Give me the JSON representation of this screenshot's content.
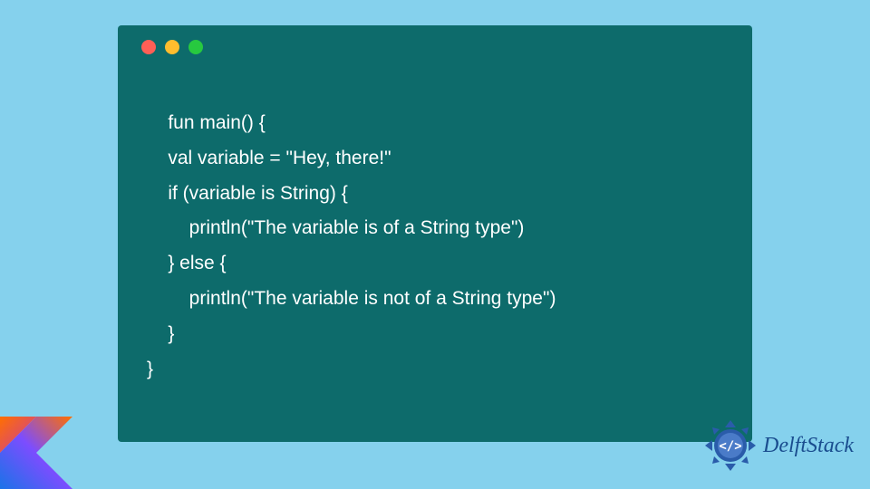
{
  "code": {
    "lines": [
      "fun main() {",
      "    val variable = \"Hey, there!\"",
      "    if (variable is String) {",
      "        println(\"The variable is of a String type\")",
      "    } else {",
      "        println(\"The variable is not of a String type\")",
      "    }",
      "}"
    ]
  },
  "branding": {
    "name": "DelftStack"
  },
  "window": {
    "dots": [
      "red",
      "yellow",
      "green"
    ]
  }
}
